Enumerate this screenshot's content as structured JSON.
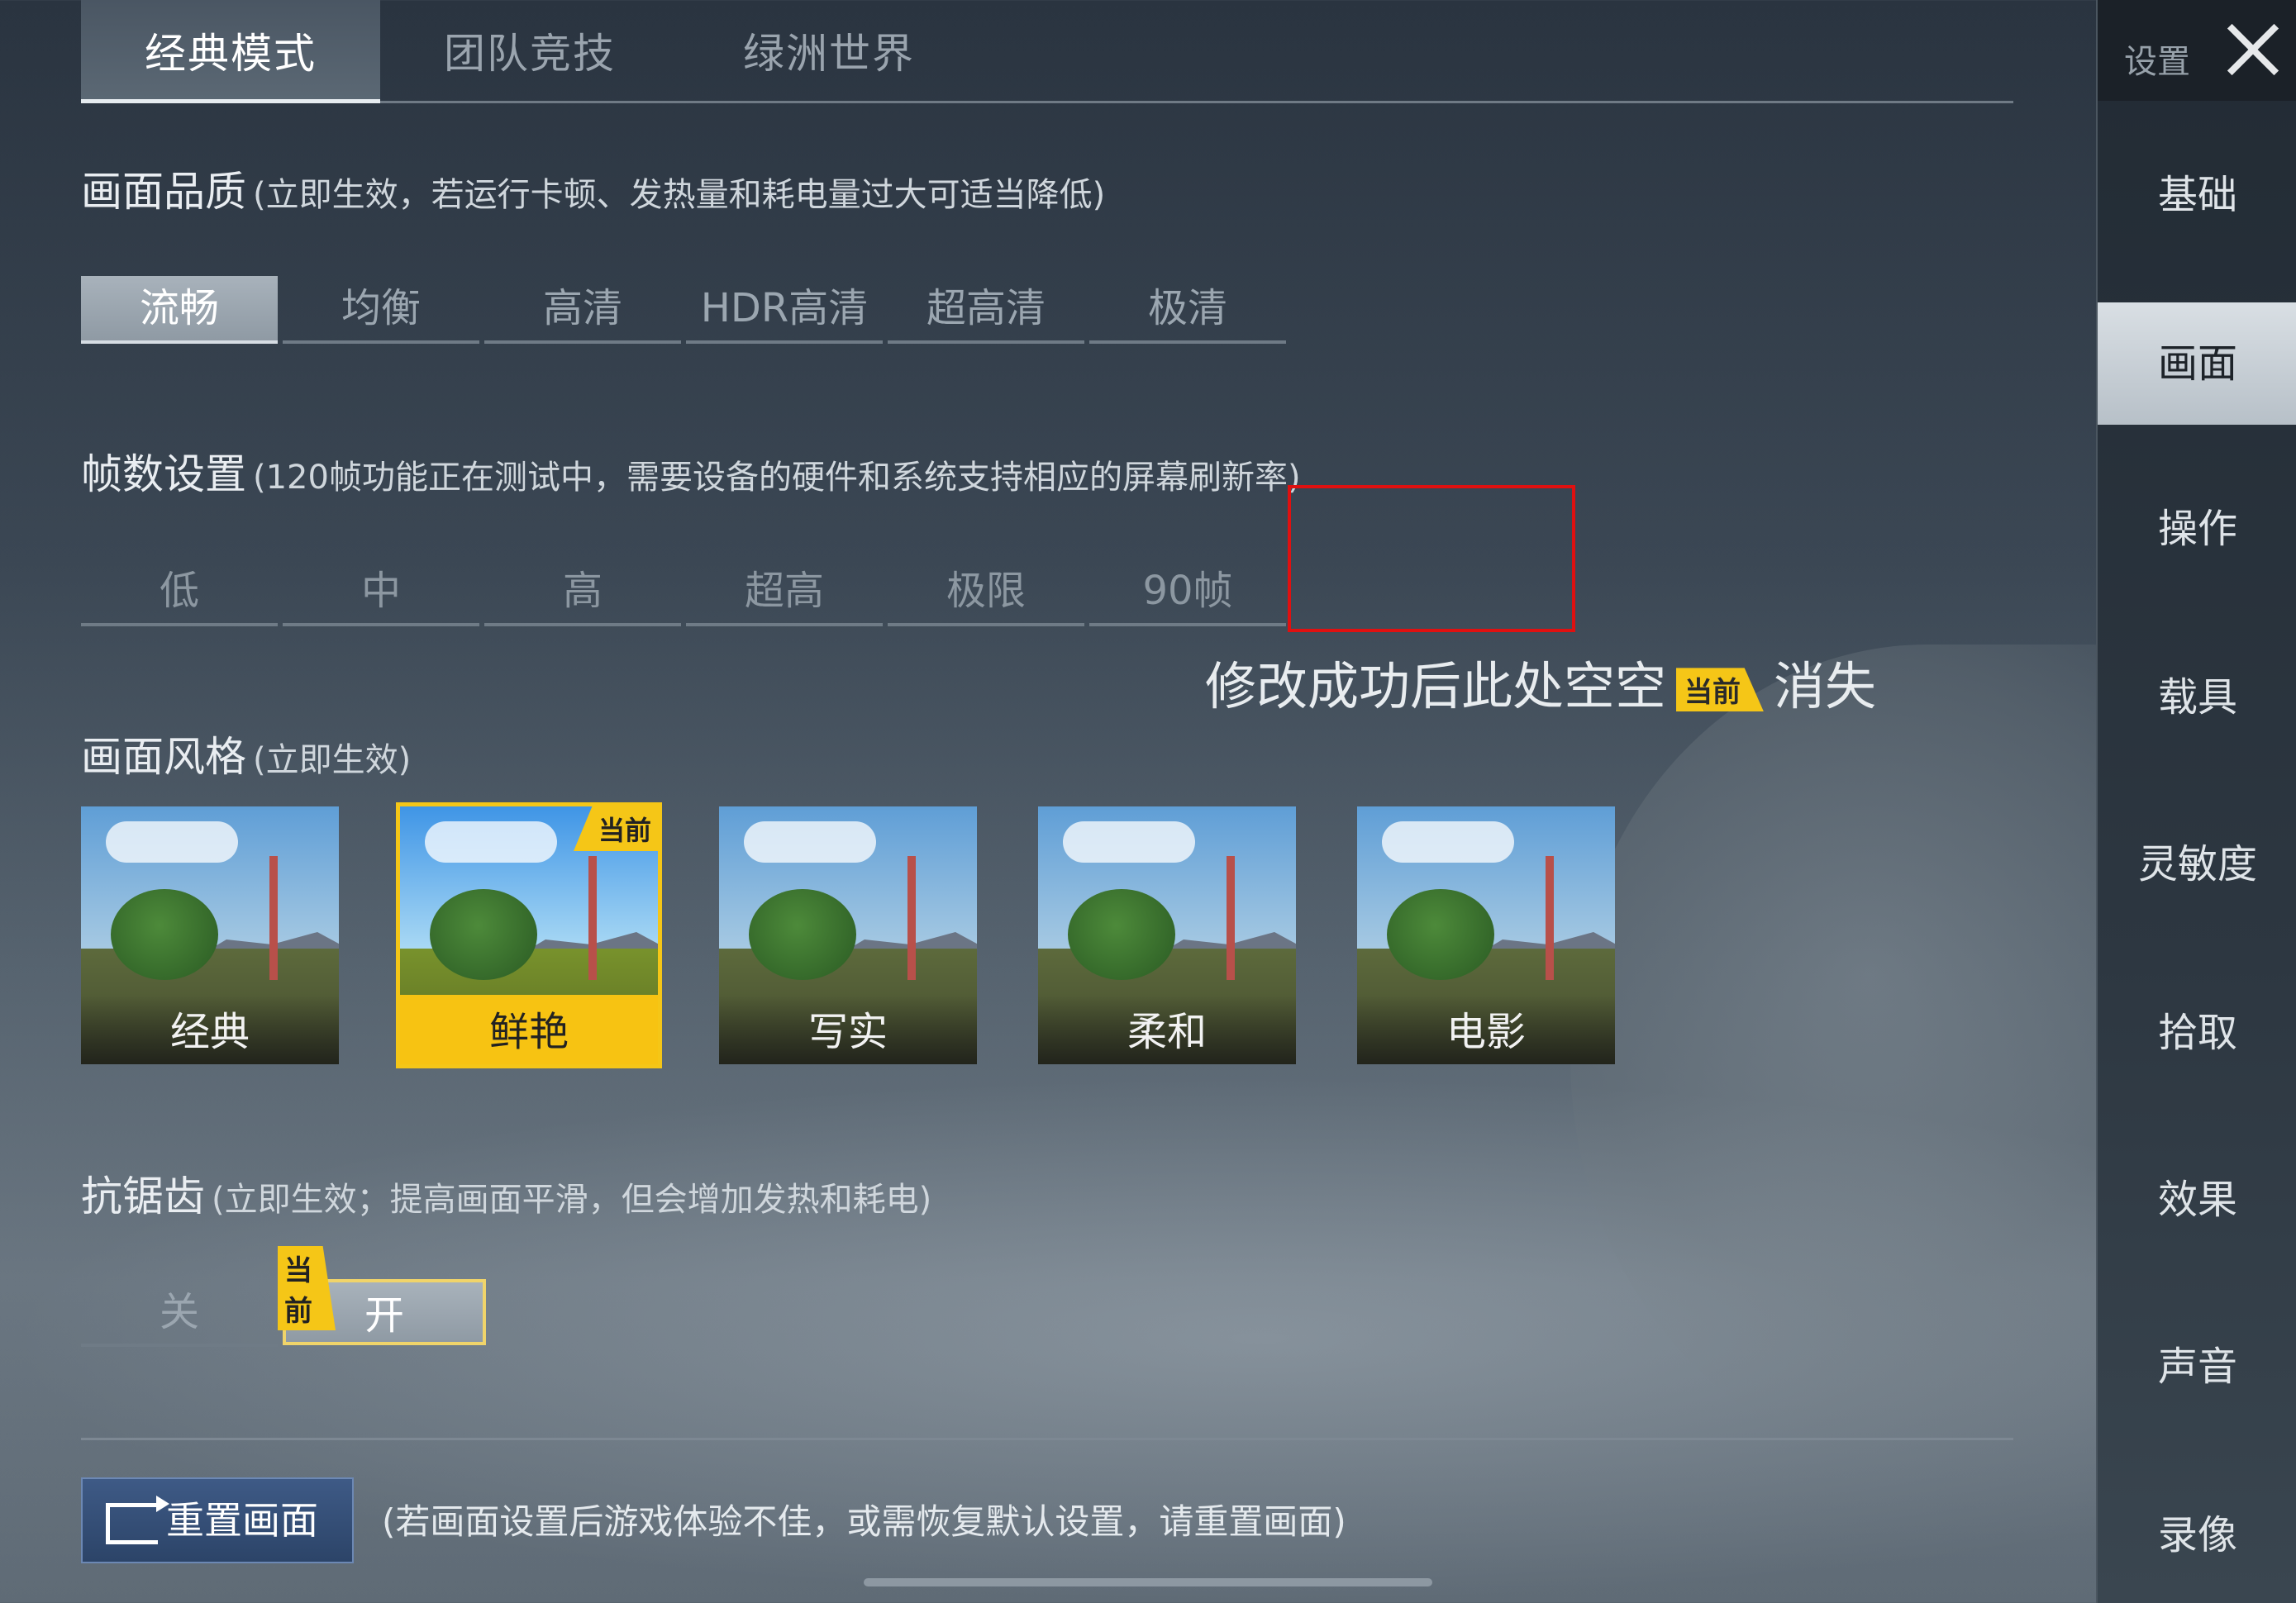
{
  "top_tabs": [
    "经典模式",
    "团队竞技",
    "绿洲世界"
  ],
  "quality": {
    "title": "画面品质",
    "note": "(立即生效，若运行卡顿、发热量和耗电量过大可适当降低)",
    "options": [
      "流畅",
      "均衡",
      "高清",
      "HDR高清",
      "超高清",
      "极清"
    ],
    "selected": "流畅"
  },
  "fps": {
    "title": "帧数设置",
    "note": "(120帧功能正在测试中，需要设备的硬件和系统支持相应的屏幕刷新率)",
    "options": [
      "低",
      "中",
      "高",
      "超高",
      "极限",
      "90帧"
    ]
  },
  "annotation": {
    "before": "修改成功后此处空空",
    "badge": "当前",
    "after": "消失",
    "box_color": "#e01010"
  },
  "style": {
    "title": "画面风格",
    "note": "(立即生效)",
    "cards": [
      "经典",
      "鲜艳",
      "写实",
      "柔和",
      "电影"
    ],
    "selected": "鲜艳",
    "current_badge": "当前"
  },
  "antialias": {
    "title": "抗锯齿",
    "note": "(立即生效；提高画面平滑，但会增加发热和耗电)",
    "options": [
      "关",
      "开"
    ],
    "selected": "开",
    "current_badge": "当前"
  },
  "reset": {
    "button": "重置画面",
    "note": "(若画面设置后游戏体验不佳，或需恢复默认设置，请重置画面)"
  },
  "sidebar": {
    "header": "设置",
    "items": [
      "基础",
      "画面",
      "操作",
      "载具",
      "灵敏度",
      "拾取",
      "效果",
      "声音",
      "录像"
    ],
    "selected": "画面"
  },
  "colors": {
    "accent_yellow": "#f5c617",
    "reset_blue": "#2c4468"
  }
}
